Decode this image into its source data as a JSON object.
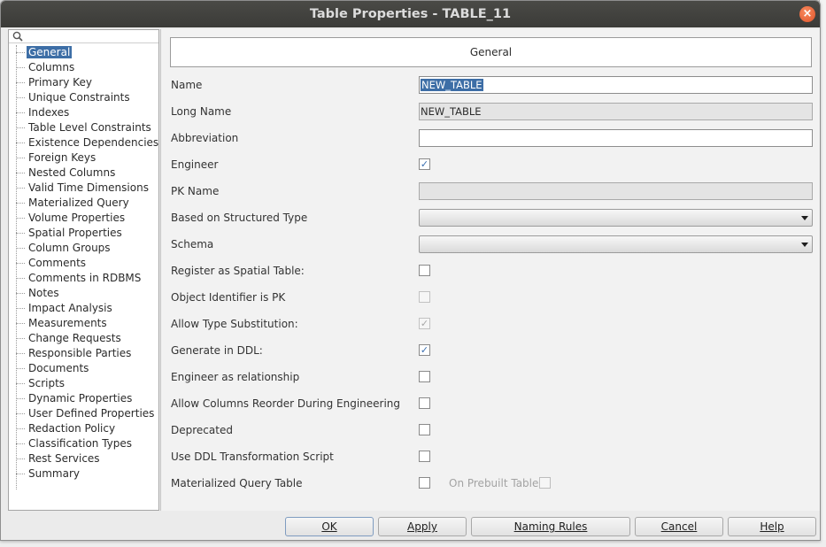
{
  "window": {
    "title": "Table Properties - TABLE_11"
  },
  "nav": {
    "items": [
      "General",
      "Columns",
      "Primary Key",
      "Unique Constraints",
      "Indexes",
      "Table Level Constraints",
      "Existence Dependencies",
      "Foreign Keys",
      "Nested Columns",
      "Valid Time Dimensions",
      "Materialized Query",
      "Volume Properties",
      "Spatial Properties",
      "Column Groups",
      "Comments",
      "Comments in RDBMS",
      "Notes",
      "Impact Analysis",
      "Measurements",
      "Change Requests",
      "Responsible Parties",
      "Documents",
      "Scripts",
      "Dynamic Properties",
      "User Defined Properties",
      "Redaction Policy",
      "Classification Types",
      "Rest Services",
      "Summary"
    ],
    "selected": "General"
  },
  "section": {
    "title": "General"
  },
  "fields": {
    "name": {
      "label": "Name",
      "value": "NEW_TABLE"
    },
    "long_name": {
      "label": "Long Name",
      "value": "NEW_TABLE"
    },
    "abbreviation": {
      "label": "Abbreviation",
      "value": ""
    },
    "engineer": {
      "label": "Engineer",
      "checked": true
    },
    "pk_name": {
      "label": "PK Name",
      "value": ""
    },
    "structured_type": {
      "label": "Based on Structured Type",
      "value": ""
    },
    "schema": {
      "label": "Schema",
      "value": ""
    },
    "spatial": {
      "label": "Register as Spatial Table:",
      "checked": false
    },
    "oid_pk": {
      "label": "Object Identifier is PK",
      "checked": false
    },
    "type_subst": {
      "label": "Allow Type Substitution:",
      "checked": true
    },
    "gen_ddl": {
      "label": "Generate in DDL:",
      "checked": true
    },
    "eng_rel": {
      "label": "Engineer as relationship",
      "checked": false
    },
    "col_reorder": {
      "label": "Allow Columns Reorder During Engineering",
      "checked": false
    },
    "deprecated": {
      "label": "Deprecated",
      "checked": false
    },
    "ddl_script": {
      "label": "Use DDL Transformation Script",
      "checked": false
    },
    "mat_query": {
      "label": "Materialized Query Table",
      "checked": false
    },
    "prebuilt": {
      "label": "On Prebuilt Table",
      "checked": false
    }
  },
  "buttons": {
    "ok": "OK",
    "apply": "Apply",
    "naming_rules": "Naming Rules",
    "cancel": "Cancel",
    "help": "Help"
  },
  "colors": {
    "selection": "#3d6ea6",
    "titlebar": "#3f3f3c",
    "close": "#e8572a"
  }
}
